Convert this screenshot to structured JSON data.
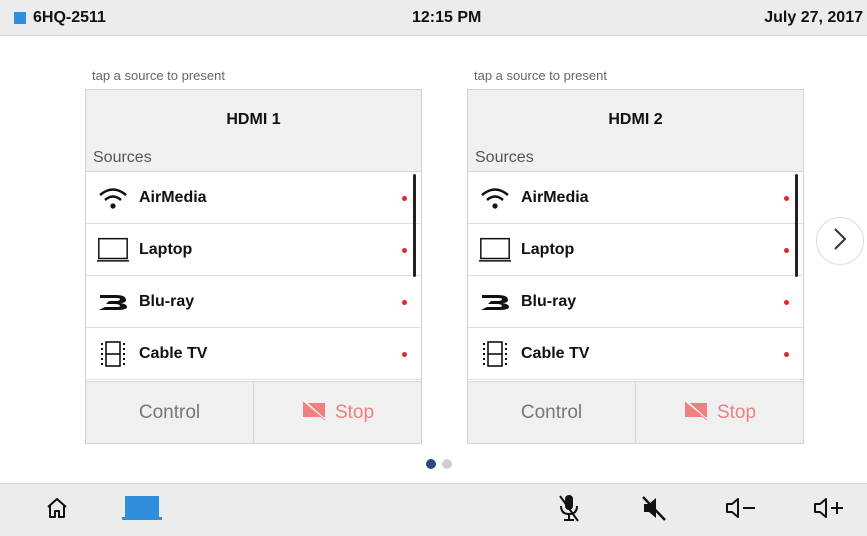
{
  "status": {
    "room": "6HQ-2511",
    "time": "12:15 PM",
    "date": "July 27, 2017",
    "room_color": "#2f8fdc"
  },
  "panels": [
    {
      "hint": "tap a source to present",
      "title": "HDMI 1",
      "sources_label": "Sources",
      "sources": [
        {
          "label": "AirMedia",
          "icon": "wifi-icon"
        },
        {
          "label": "Laptop",
          "icon": "laptop-icon"
        },
        {
          "label": "Blu-ray",
          "icon": "bluray-icon"
        },
        {
          "label": "Cable TV",
          "icon": "film-icon"
        }
      ],
      "control_label": "Control",
      "stop_label": "Stop"
    },
    {
      "hint": "tap a source to present",
      "title": "HDMI 2",
      "sources_label": "Sources",
      "sources": [
        {
          "label": "AirMedia",
          "icon": "wifi-icon"
        },
        {
          "label": "Laptop",
          "icon": "laptop-icon"
        },
        {
          "label": "Blu-ray",
          "icon": "bluray-icon"
        },
        {
          "label": "Cable TV",
          "icon": "film-icon"
        }
      ],
      "control_label": "Control",
      "stop_label": "Stop"
    }
  ],
  "pager": {
    "pages": 2,
    "current": 1
  },
  "colors": {
    "active_dot": "#e5262f",
    "stop": "#f08080",
    "accent": "#2f8fdc"
  },
  "bottom_bar": [
    "home-icon",
    "display-icon",
    "mic-mute-icon",
    "speaker-mute-icon",
    "volume-down-icon",
    "volume-up-icon"
  ]
}
